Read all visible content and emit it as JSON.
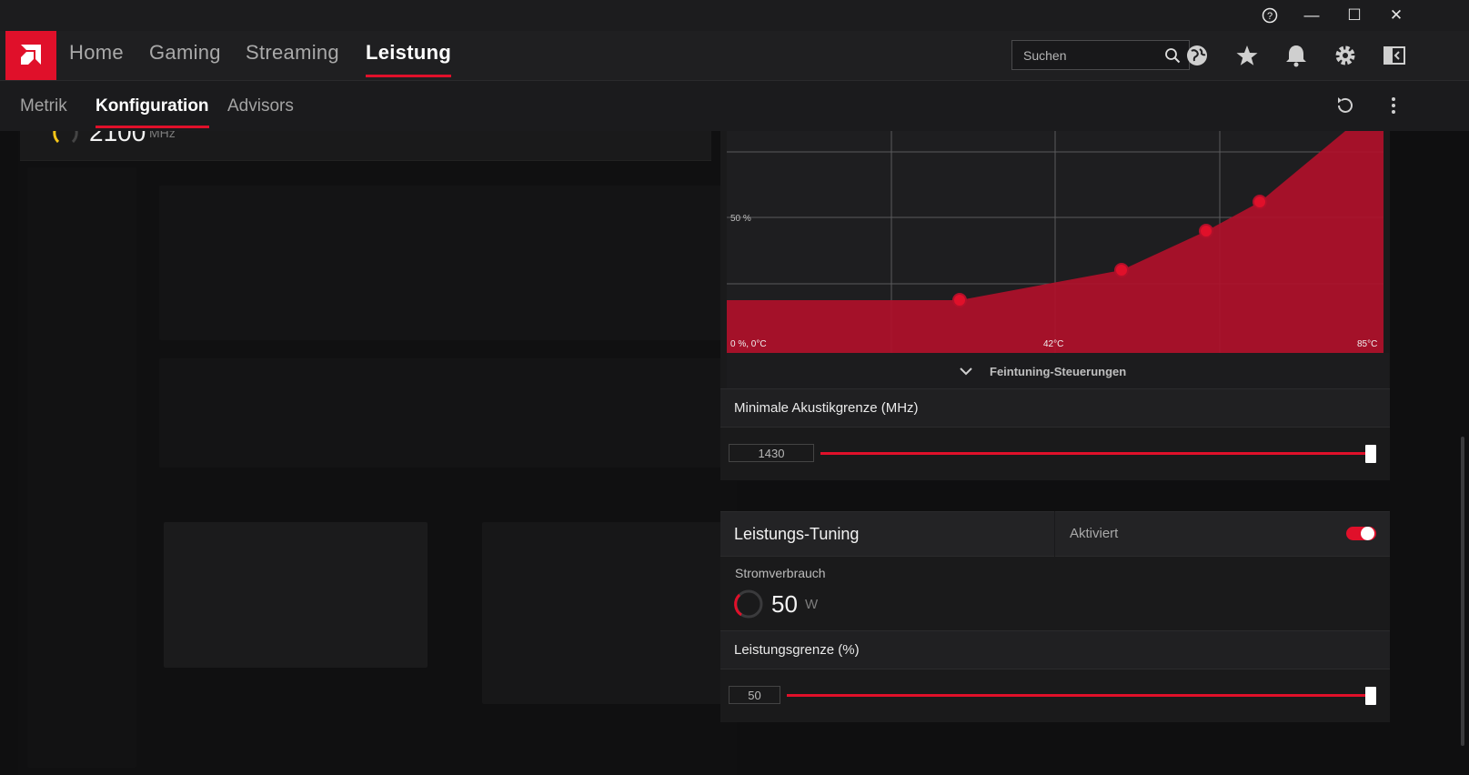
{
  "titlebar": {
    "help": "?",
    "minimize": "—",
    "maximize": "☐",
    "close": "✕"
  },
  "nav": {
    "home": "Home",
    "gaming": "Gaming",
    "streaming": "Streaming",
    "performance": "Leistung"
  },
  "search": {
    "placeholder": "Suchen"
  },
  "subnav": {
    "metrics": "Metrik",
    "config": "Konfiguration",
    "advisors": "Advisors"
  },
  "clock": {
    "value": "2100",
    "unit": "MHz"
  },
  "fan_curve": {
    "y_mid_label": "50 %",
    "origin_label": "0 %, 0°C",
    "x_mid_label": "42°C",
    "x_max_label": "85°C",
    "points": [
      [
        25,
        26
      ],
      [
        52,
        36
      ],
      [
        66,
        50
      ],
      [
        76,
        60
      ]
    ]
  },
  "finetune": {
    "label": "Feintuning-Steuerungen"
  },
  "acoustic": {
    "title": "Minimale Akustikgrenze (MHz)",
    "value": "1430",
    "level": 1.0
  },
  "tuning": {
    "title": "Leistungs-Tuning",
    "status": "Aktiviert"
  },
  "power": {
    "label": "Stromverbrauch",
    "value": "50",
    "unit": "W"
  },
  "power_limit": {
    "title": "Leistungsgrenze (%)",
    "value": "50",
    "level": 1.0
  },
  "colors": {
    "accent": "#e0102a",
    "chart_fill": "#b0102a"
  }
}
